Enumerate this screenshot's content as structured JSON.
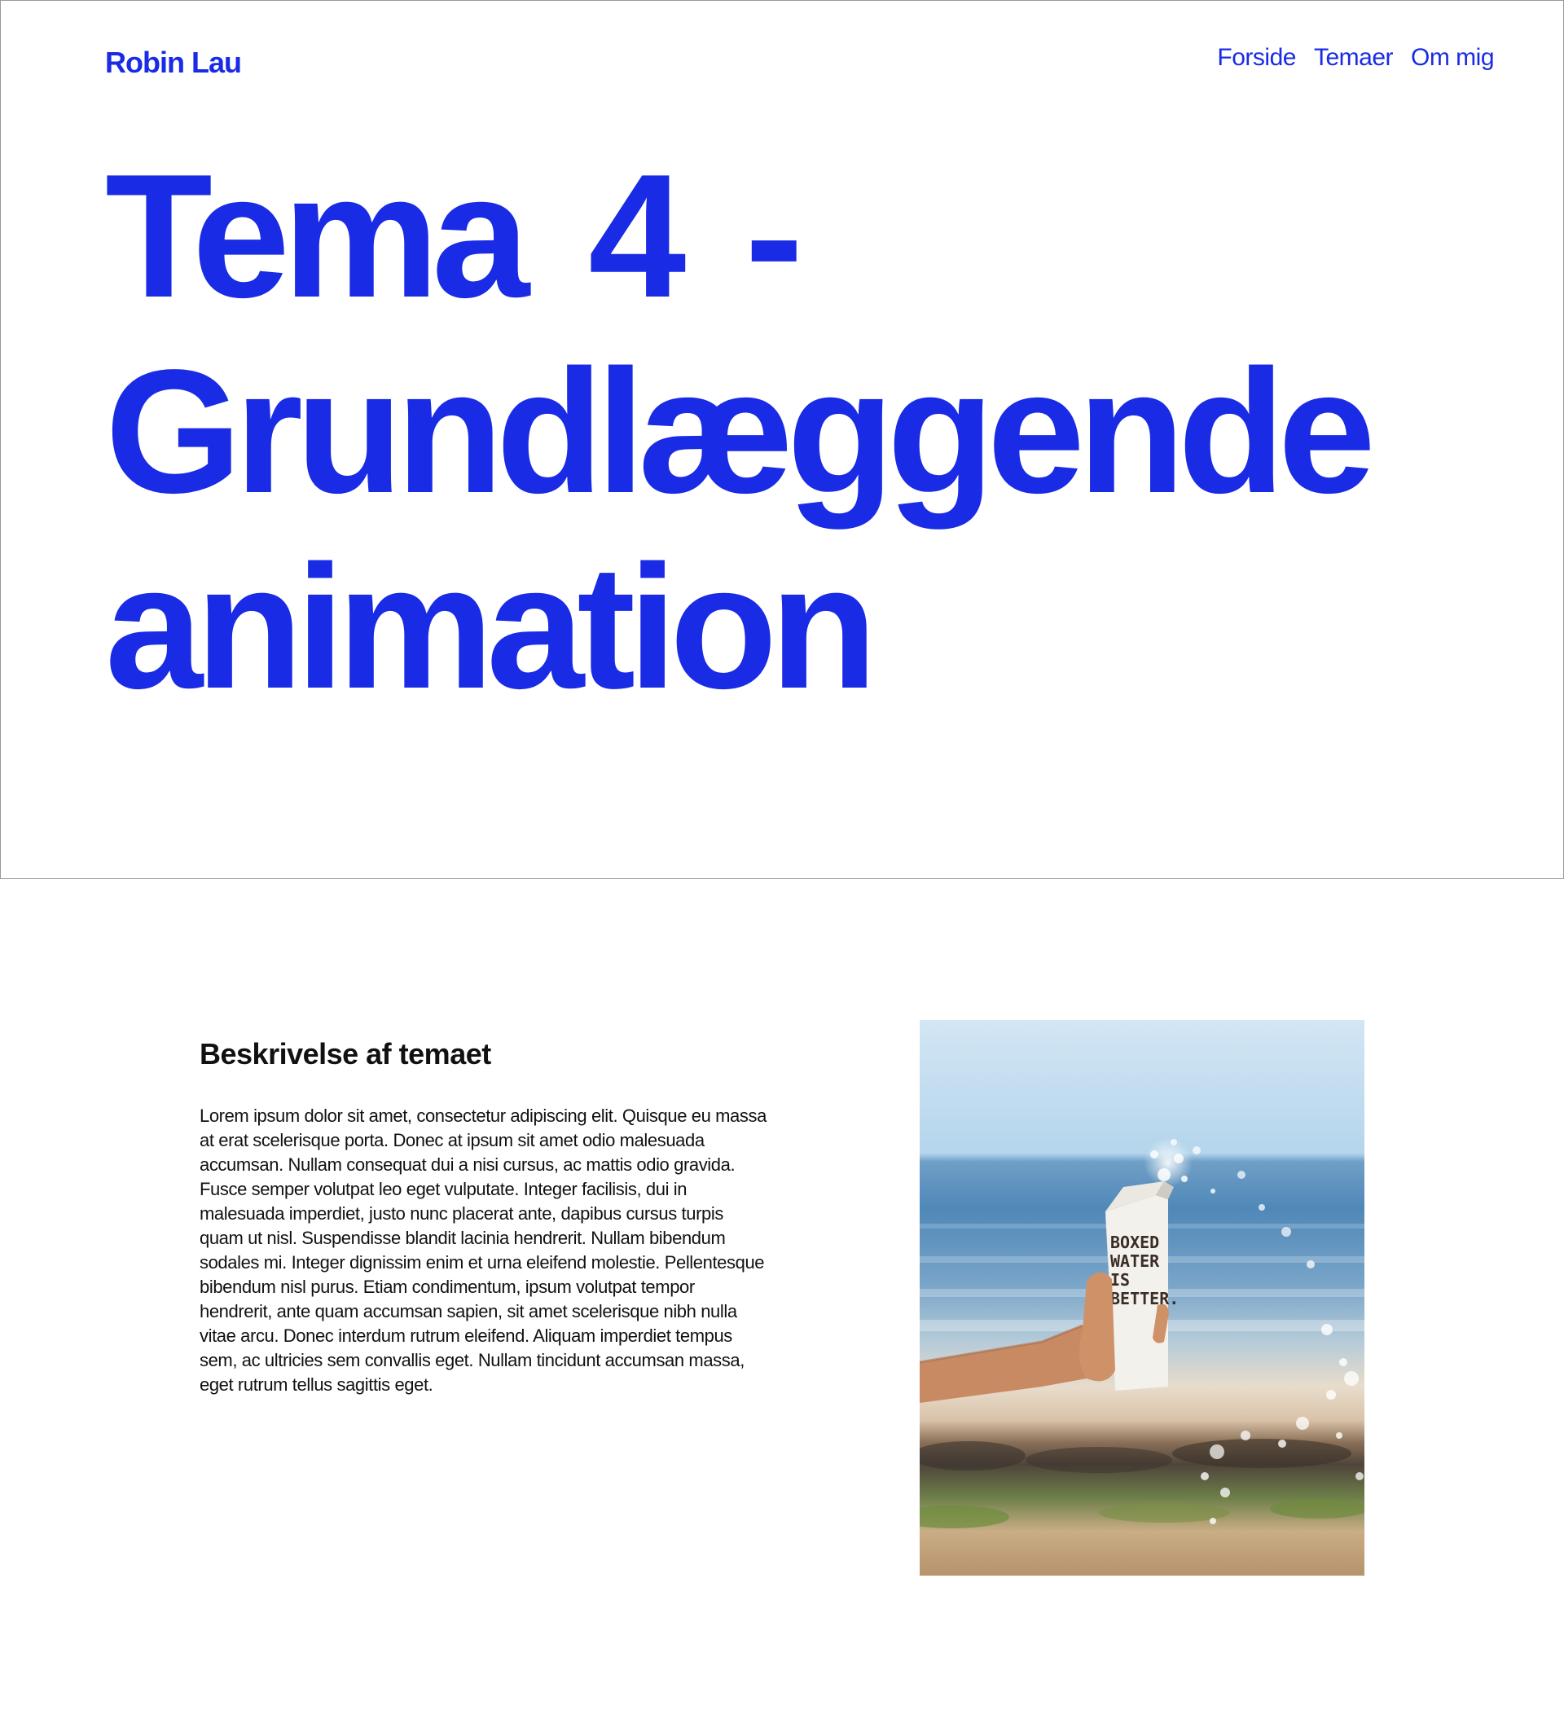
{
  "header": {
    "logo": "Robin Lau",
    "nav": [
      "Forside",
      "Temaer",
      "Om mig"
    ]
  },
  "hero": {
    "title_line1": "Tema 4 -",
    "title_line2": "Grundlæggende",
    "title_line3": "animation"
  },
  "description": {
    "heading": "Beskrivelse af temaet",
    "body": "Lorem ipsum dolor sit amet, consectetur adipiscing elit. Quisque eu massa at erat scelerisque porta. Donec at ipsum sit amet odio malesuada accumsan. Nullam consequat dui a nisi cursus, ac mattis odio gravida. Fusce semper volutpat leo eget vulputate. Integer facilisis, dui in malesuada imperdiet, justo nunc placerat ante, dapibus cursus turpis quam ut nisl. Suspendisse blandit lacinia hendrerit. Nullam bibendum sodales mi. Integer dignissim enim et urna eleifend molestie. Pellentesque bibendum nisl purus. Etiam condimentum, ipsum volutpat tempor hendrerit, ante quam accumsan sapien, sit amet scelerisque nibh nulla vitae arcu. Donec interdum rutrum eleifend. Aliquam imperdiet tempus sem, ac ultricies sem convallis eget. Nullam tincidunt accumsan massa, eget rutrum tellus sagittis eget."
  },
  "photo": {
    "carton_text": [
      "BOXED",
      "WATER",
      "IS",
      "BETTER."
    ]
  },
  "colors": {
    "accent": "#1a2be6",
    "text": "#111111",
    "background": "#ffffff"
  }
}
